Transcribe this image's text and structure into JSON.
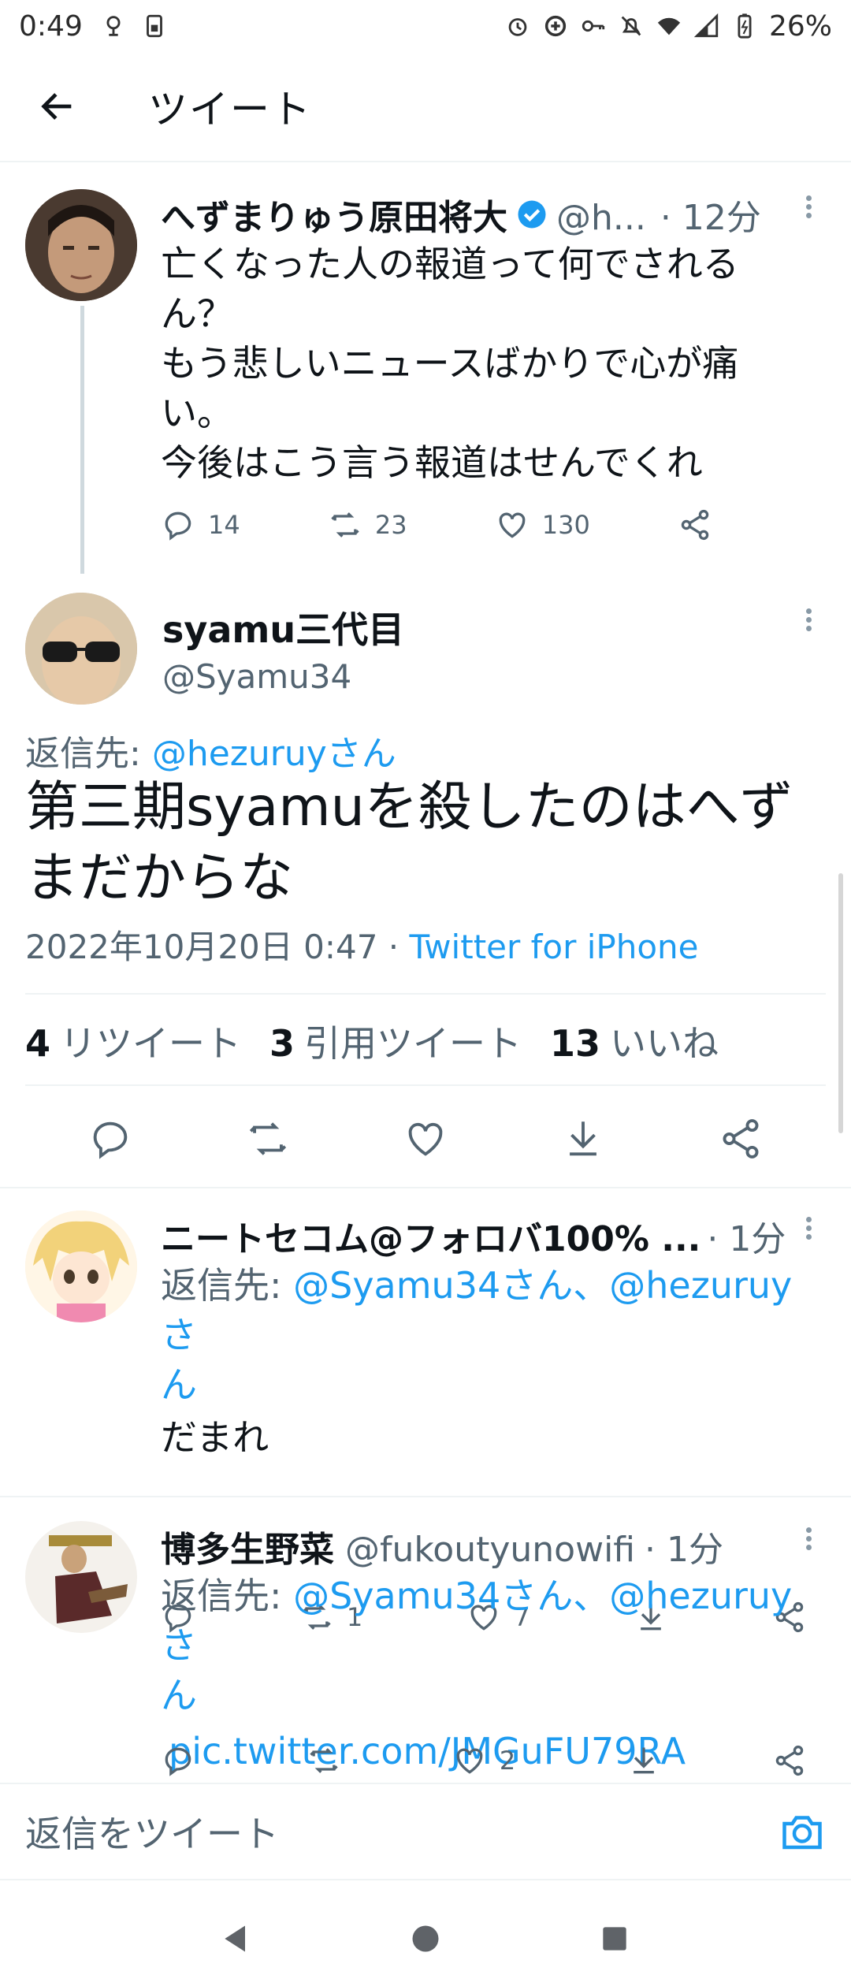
{
  "status_bar": {
    "time": "0:49",
    "battery": "26%",
    "left_icons": [
      "assistant-icon",
      "sim-icon"
    ],
    "right_icons": [
      "alarm-icon",
      "data-saver-icon",
      "vpn-key-icon",
      "mute-icon",
      "wifi-icon",
      "signal-icon",
      "battery-icon"
    ]
  },
  "header": {
    "title": "ツイート",
    "back_icon": "arrow-left-icon"
  },
  "parent_tweet": {
    "name": "へずまりゅう原田将大",
    "handle": "@h...",
    "time": "· 12分",
    "text_lines": [
      "亡くなった人の報道って何でされる",
      "ん？",
      "もう悲しいニュースばかりで心が痛",
      "い。",
      "今後はこう言う報道はせんでくれ"
    ],
    "replies": "14",
    "retweets": "23",
    "likes": "130"
  },
  "main_tweet": {
    "name": "syamu三代目",
    "handle": "@Syamu34",
    "reply_prefix": "返信先: ",
    "reply_to": "@hezuruyさん",
    "text_lines": [
      "第三期syamuを殺したのはへず",
      "まだからな"
    ],
    "date": "2022年10月20日 0:47 · ",
    "source": "Twitter for iPhone",
    "retweets_count": "4",
    "retweets_label": "リツイート",
    "quotes_count": "3",
    "quotes_label": "引用ツイート",
    "likes_count": "13",
    "likes_label": "いいね"
  },
  "reply1": {
    "name": "ニートセコム@フォロバ100% ...",
    "time": "· 1分",
    "reply_prefix": "返信先: ",
    "reply_to_line1": "@Syamu34さん、@hezuruyさ",
    "reply_to_line2": "ん",
    "text": "だまれ",
    "retweets": "1",
    "likes": "7"
  },
  "reply2": {
    "name": "博多生野菜",
    "handle": "@fukoutyunowifi",
    "time": "· 1分",
    "reply_prefix": "返信先: ",
    "reply_to_line1": "@Syamu34さん、@hezuruyさ",
    "reply_to_line2": "ん",
    "link": "pic.twitter.com/JMGuFU79RA",
    "likes": "2"
  },
  "reply_bar": {
    "placeholder": "返信をツイート"
  },
  "colors": {
    "accent": "#1d9bf0",
    "muted": "#536471",
    "text": "#0f1419",
    "divider": "#eff3f4"
  }
}
